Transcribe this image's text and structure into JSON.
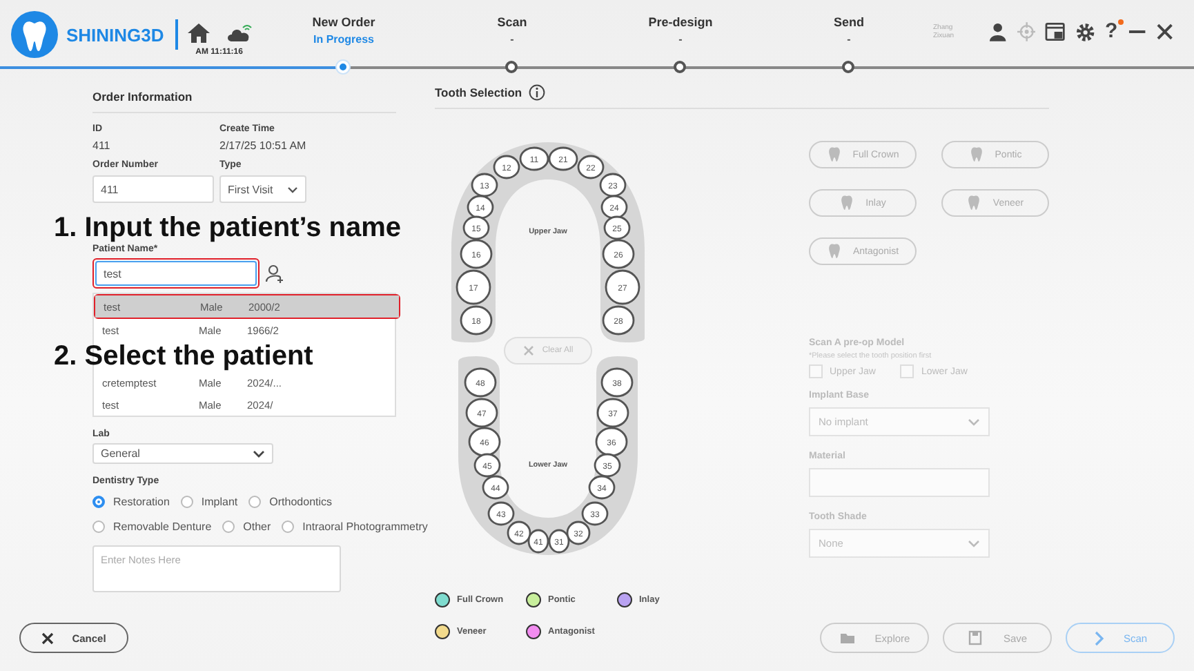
{
  "header": {
    "brand": "SHINING3D",
    "time": "AM 11:11:16",
    "user": "Zhang Zixuan",
    "help": "?",
    "notification": true
  },
  "steps": [
    {
      "label": "New Order",
      "status": "In Progress",
      "selected": true
    },
    {
      "label": "Scan",
      "status": "-",
      "selected": false
    },
    {
      "label": "Pre-design",
      "status": "-",
      "selected": false
    },
    {
      "label": "Send",
      "status": "-",
      "selected": false
    }
  ],
  "order_info": {
    "title": "Order Information",
    "fields": [
      {
        "label": "ID",
        "value": "411"
      },
      {
        "label": "Create Time",
        "value": "2/17/25 10:51 AM"
      }
    ],
    "order_number": {
      "label": "Order Number",
      "value": "411"
    },
    "type": {
      "label": "Type",
      "value": "First Visit"
    },
    "patient": {
      "label": "Patient Name*",
      "value": "test"
    },
    "patient_matches": [
      {
        "name": "test",
        "sex": "Male",
        "birth": "2000/2",
        "selected": true
      },
      {
        "name": "test",
        "sex": "Male",
        "birth": "1966/2",
        "selected": false
      },
      {
        "name": "cretemptest",
        "sex": "Male",
        "birth": "2024/...",
        "selected": false
      },
      {
        "name": "test",
        "sex": "Male",
        "birth": "2024/",
        "selected": false
      }
    ],
    "lab": {
      "label": "Lab",
      "value": "General"
    },
    "dentistry_type": {
      "label": "Dentistry Type",
      "options": [
        {
          "label": "Restoration",
          "selected": true
        },
        {
          "label": "Implant",
          "selected": false
        },
        {
          "label": "Orthodontics",
          "selected": false
        },
        {
          "label": "Removable Denture",
          "selected": false
        },
        {
          "label": "Other",
          "selected": false
        },
        {
          "label": "Intraoral Photogrammetry",
          "selected": false
        }
      ]
    },
    "notes": {
      "placeholder": "Enter Notes Here"
    }
  },
  "annotations": [
    "1. Input the patient’s name",
    "2. Select the patient"
  ],
  "tooth_selection": {
    "title": "Tooth Selection",
    "upper_jaw": {
      "label": "Upper Jaw",
      "teeth": [
        {
          "number": "11",
          "selected": false
        },
        {
          "number": "21",
          "selected": false
        },
        {
          "number": "12",
          "selected": false
        },
        {
          "number": "22",
          "selected": false
        },
        {
          "number": "13",
          "selected": false
        },
        {
          "number": "23",
          "selected": false
        },
        {
          "number": "14",
          "selected": false
        },
        {
          "number": "24",
          "selected": false
        },
        {
          "number": "15",
          "selected": false
        },
        {
          "number": "25",
          "selected": false
        },
        {
          "number": "16",
          "selected": false
        },
        {
          "number": "26",
          "selected": false
        },
        {
          "number": "17",
          "selected": false
        },
        {
          "number": "27",
          "selected": false
        },
        {
          "number": "18",
          "selected": false
        },
        {
          "number": "28",
          "selected": false
        }
      ]
    },
    "lower_jaw": {
      "label": "Lower Jaw",
      "teeth": [
        {
          "number": "48",
          "selected": false
        },
        {
          "number": "38",
          "selected": false
        },
        {
          "number": "47",
          "selected": false
        },
        {
          "number": "37",
          "selected": false
        },
        {
          "number": "46",
          "selected": false
        },
        {
          "number": "36",
          "selected": false
        },
        {
          "number": "45",
          "selected": false
        },
        {
          "number": "35",
          "selected": false
        },
        {
          "number": "44",
          "selected": false
        },
        {
          "number": "34",
          "selected": false
        },
        {
          "number": "43",
          "selected": false
        },
        {
          "number": "33",
          "selected": false
        },
        {
          "number": "42",
          "selected": false
        },
        {
          "number": "32",
          "selected": false
        },
        {
          "number": "41",
          "selected": false
        },
        {
          "number": "31",
          "selected": false
        }
      ]
    },
    "clear_button": {
      "label": "Clear All",
      "disabled": true
    },
    "legend": [
      {
        "label": "Full Crown",
        "color": "#7fdccf"
      },
      {
        "label": "Pontic",
        "color": "#c8ef9c"
      },
      {
        "label": "Inlay",
        "color": "#b9a2f2"
      },
      {
        "label": "Veneer",
        "color": "#f2da8c"
      },
      {
        "label": "Antagonist",
        "color": "#f28cf0"
      }
    ]
  },
  "restoration_types": [
    {
      "label": "Full Crown",
      "disabled": true
    },
    {
      "label": "Pontic",
      "disabled": true
    },
    {
      "label": "Inlay",
      "disabled": true
    },
    {
      "label": "Veneer",
      "disabled": true
    },
    {
      "label": "Antagonist",
      "disabled": true
    }
  ],
  "preop": {
    "title": "Scan A pre-op Model",
    "note": "*Please select the tooth position first",
    "checkboxes": [
      {
        "label": "Upper Jaw",
        "checked": false
      },
      {
        "label": "Lower Jaw",
        "checked": false
      }
    ]
  },
  "implant_base": {
    "label": "Implant Base",
    "value": "No implant"
  },
  "material": {
    "label": "Material"
  },
  "tooth_shade": {
    "label": "Tooth Shade",
    "value": "None"
  },
  "footer": {
    "cancel": "Cancel",
    "buttons": [
      {
        "label": "Explore",
        "kind": "normal",
        "disabled": true
      },
      {
        "label": "Save",
        "kind": "normal",
        "disabled": true
      },
      {
        "label": "Scan",
        "kind": "primary",
        "disabled": true
      }
    ]
  }
}
